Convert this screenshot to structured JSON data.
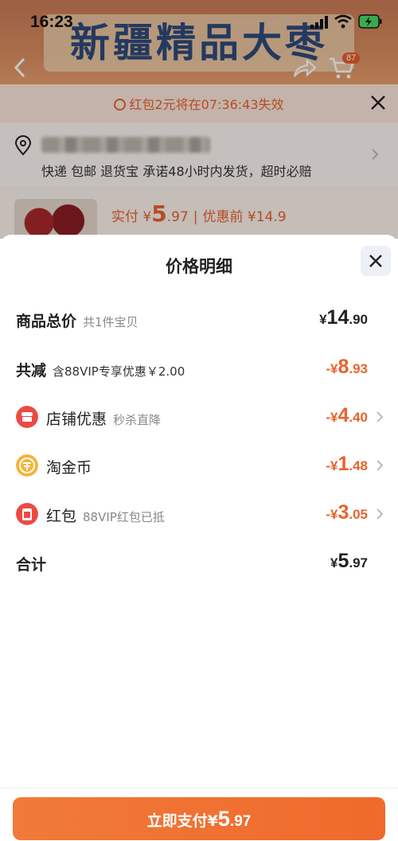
{
  "status_bar": {
    "time": "16:23"
  },
  "banner": {
    "title": "新疆精品大枣"
  },
  "cart": {
    "badge": "87"
  },
  "coupon_notice": {
    "text": "红包2元将在07:36:43失效"
  },
  "address": {
    "shipping": "快递 包邮 退货宝 承诺48小时内发货，超时必赔"
  },
  "product": {
    "pay_label": "实付 ¥",
    "pay_int": "5",
    "pay_dec": ".97",
    "separator": "|",
    "original_label": "优惠前 ¥14.9"
  },
  "sheet": {
    "title": "价格明细",
    "rows": [
      {
        "label": "商品总价",
        "sub": "共1件宝贝",
        "sym": "¥",
        "int": "14",
        "dec": ".90"
      },
      {
        "label": "共减",
        "sub": "含88VIP专享优惠￥2.00",
        "sym": "-¥",
        "int": "8",
        "dec": ".93"
      },
      {
        "label": "店铺优惠",
        "sub": "秒杀直降",
        "sym": "-¥",
        "int": "4",
        "dec": ".40",
        "icon": "shop-icon"
      },
      {
        "label": "淘金币",
        "sub": "",
        "sym": "-¥",
        "int": "1",
        "dec": ".48",
        "icon": "coin-icon"
      },
      {
        "label": "红包",
        "sub": "88VIP红包已抵",
        "sym": "-¥",
        "int": "3",
        "dec": ".05",
        "icon": "red-packet-icon"
      },
      {
        "label": "合计",
        "sub": "",
        "sym": "¥",
        "int": "5",
        "dec": ".97"
      }
    ]
  },
  "pay_button": {
    "label": "立即支付",
    "sym": "¥",
    "int": "5",
    "dec": ".97"
  },
  "colors": {
    "accent": "#e8622c",
    "button": "#ef6a2b",
    "text": "#222222"
  }
}
